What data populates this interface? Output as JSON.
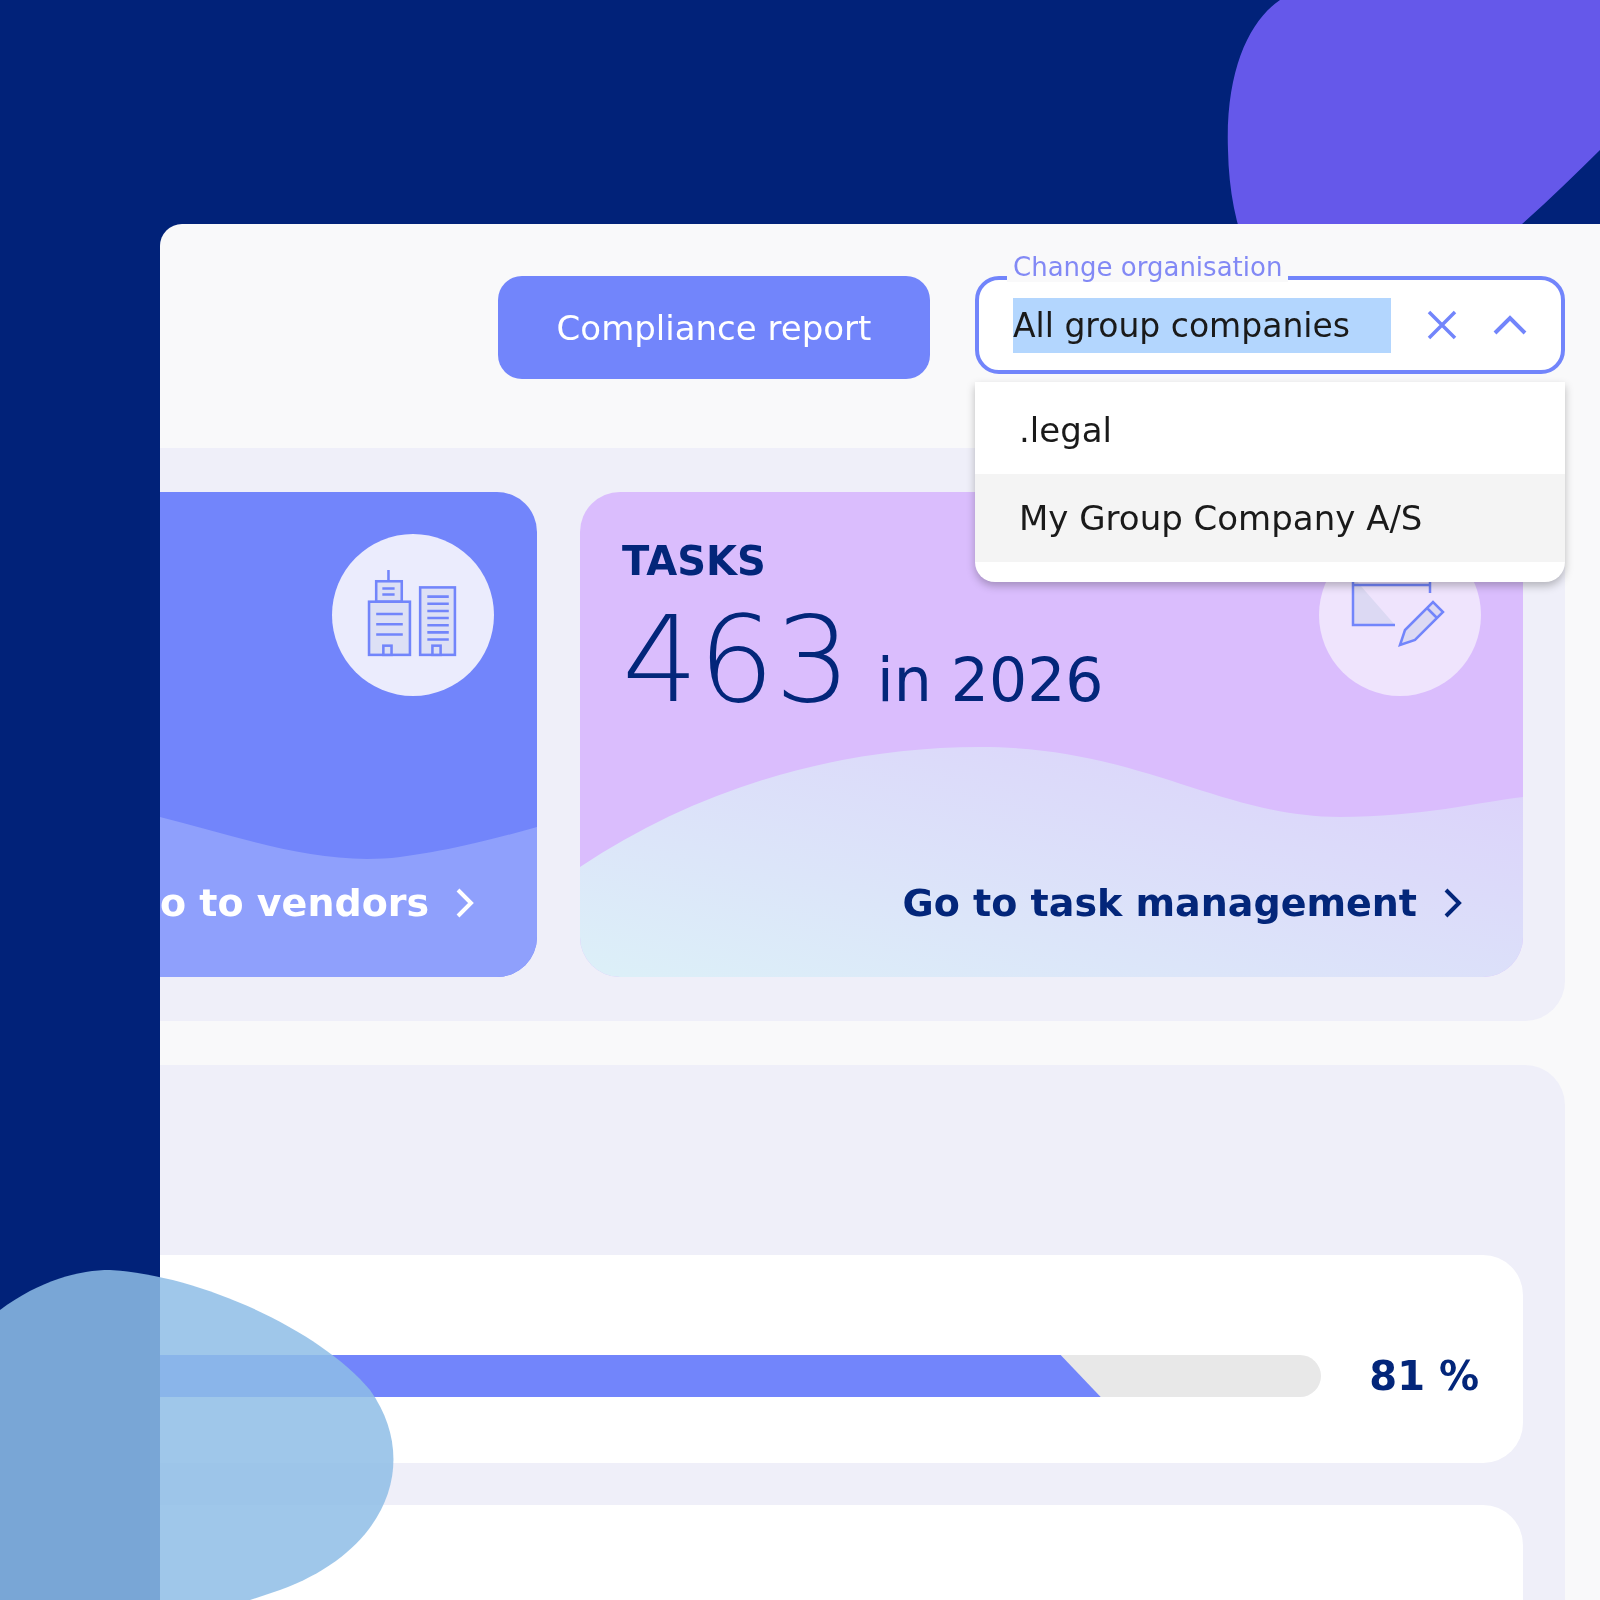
{
  "header": {
    "compliance_button": "Compliance report",
    "organisation_select": {
      "label": "Change organisation",
      "value": "All group companies",
      "expanded": true,
      "options": [
        {
          "label": ".legal",
          "highlighted": false
        },
        {
          "label": "My Group Company A/S",
          "highlighted": true
        }
      ]
    }
  },
  "cards": [
    {
      "kind": "vendors",
      "link": "o to vendors"
    },
    {
      "kind": "tasks",
      "title": "TASKS",
      "count": "463",
      "period": "in 2026",
      "link": "Go to task management"
    }
  ],
  "progress": {
    "level": 0.81,
    "reading": "81 %"
  }
}
